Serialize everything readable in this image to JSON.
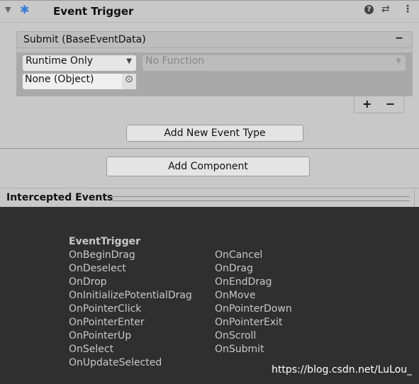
{
  "component": {
    "title": "Event Trigger",
    "icons": [
      "foldout-arrow-icon",
      "event-trigger-icon",
      "help-icon",
      "preset-icon",
      "more-icon"
    ]
  },
  "event_entry": {
    "title": "Submit (BaseEventData)",
    "remove": "−",
    "runtime": "Runtime Only",
    "function": "No Function",
    "object": "None (Object)",
    "add": "+",
    "minus": "−"
  },
  "buttons": {
    "add_event": "Add New Event Type",
    "add_component": "Add Component"
  },
  "intercepted": {
    "title": "Intercepted Events",
    "header": "EventTrigger",
    "col1": [
      "OnBeginDrag",
      "OnDeselect",
      "OnDrop",
      "OnInitializePotentialDrag",
      "OnPointerClick",
      "OnPointerEnter",
      "OnPointerUp",
      "OnSelect",
      "OnUpdateSelected"
    ],
    "col2": [
      "OnCancel",
      "OnDrag",
      "OnEndDrag",
      "OnMove",
      "OnPointerDown",
      "OnPointerExit",
      "OnScroll",
      "OnSubmit"
    ]
  },
  "watermark": "https://blog.csdn.net/LuLou_"
}
